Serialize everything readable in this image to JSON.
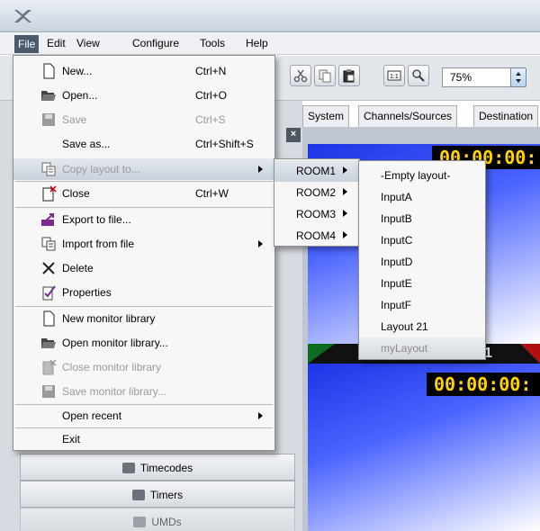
{
  "menubar": {
    "items": [
      "File",
      "Edit",
      "View",
      "Configure",
      "Tools",
      "Help"
    ]
  },
  "toolbar": {
    "zoom_value": "75%"
  },
  "tabs": [
    "System",
    "Channels/Sources",
    "Destination"
  ],
  "file_menu": {
    "items": [
      {
        "label": "New...",
        "shortcut": "Ctrl+N",
        "icon": "new-document-icon"
      },
      {
        "label": "Open...",
        "shortcut": "Ctrl+O",
        "icon": "open-folder-icon"
      },
      {
        "label": "Save",
        "shortcut": "Ctrl+S",
        "icon": "save-disk-icon",
        "disabled": true
      },
      {
        "label": "Save as...",
        "shortcut": "Ctrl+Shift+S"
      },
      {
        "label": "Copy layout to...",
        "icon": "copy-layout-icon",
        "disabled": true,
        "submenu": true
      },
      {
        "label": "Close",
        "shortcut": "Ctrl+W",
        "icon": "close-document-icon"
      },
      {
        "label": "Export to file...",
        "icon": "export-icon"
      },
      {
        "label": "Import from file",
        "icon": "import-icon",
        "submenu": true
      },
      {
        "label": "Delete",
        "icon": "delete-x-icon"
      },
      {
        "label": "Properties",
        "icon": "properties-icon"
      },
      {
        "label": "New monitor library",
        "icon": "new-library-icon"
      },
      {
        "label": "Open monitor library...",
        "icon": "open-library-icon"
      },
      {
        "label": "Close monitor library",
        "icon": "close-library-icon",
        "disabled": true
      },
      {
        "label": "Save monitor library...",
        "icon": "save-library-icon",
        "disabled": true
      },
      {
        "label": "Open recent",
        "submenu": true
      },
      {
        "label": "Exit"
      }
    ]
  },
  "rooms_menu": {
    "items": [
      "ROOM1",
      "ROOM2",
      "ROOM3",
      "ROOM4"
    ]
  },
  "layouts_menu": {
    "items": [
      {
        "label": "-Empty layout-"
      },
      {
        "label": "InputA"
      },
      {
        "label": "InputB"
      },
      {
        "label": "InputC"
      },
      {
        "label": "InputD"
      },
      {
        "label": "InputE"
      },
      {
        "label": "InputF"
      },
      {
        "label": "Layout 21"
      },
      {
        "label": "myLayout",
        "disabled": true
      }
    ]
  },
  "left_panel": {
    "items": [
      "Timecodes",
      "Timers",
      "UMDs"
    ]
  },
  "monitors": {
    "timecode_1": "00:00:00:",
    "timecode_2": "00:00:00:",
    "channel_number": "1"
  },
  "colors": {
    "timecode_text": "#ffd400",
    "pane_blue": "#1e33e6",
    "menu_bg": "#f7f7f7"
  }
}
